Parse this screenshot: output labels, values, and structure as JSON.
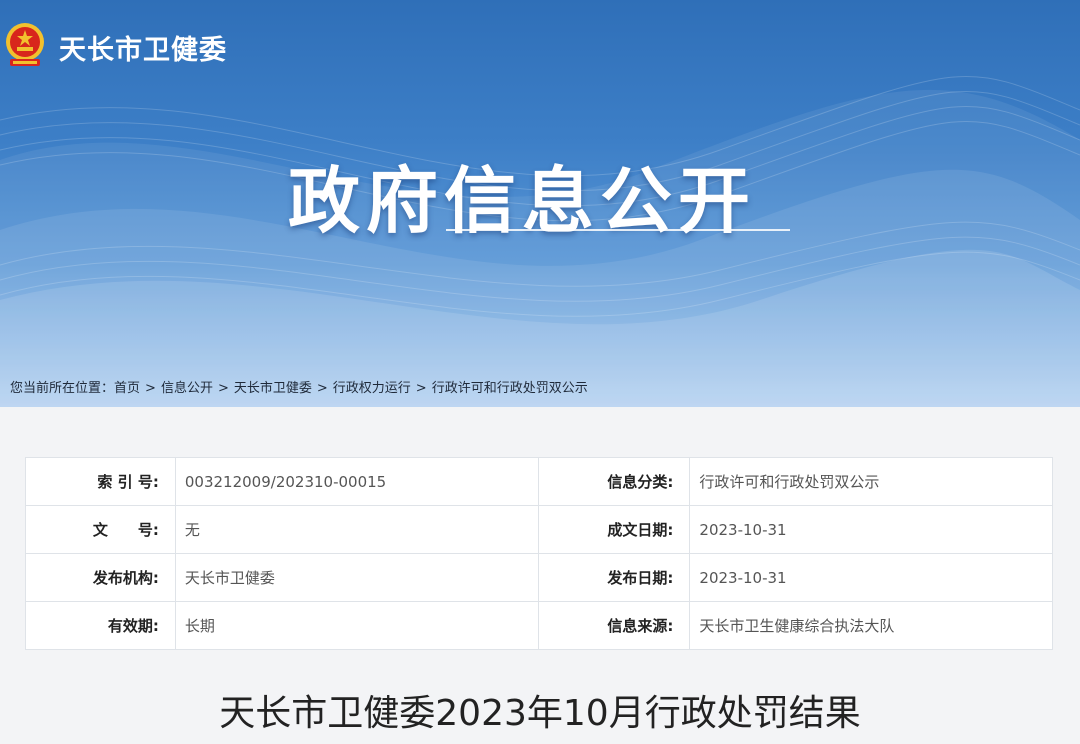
{
  "header": {
    "site_name": "天长市卫健委",
    "hero_title": "政府信息公开"
  },
  "breadcrumb": {
    "prefix": "您当前所在位置：",
    "items": [
      "首页",
      "信息公开",
      "天长市卫健委",
      "行政权力运行",
      "行政许可和行政处罚双公示"
    ]
  },
  "info": {
    "rows": [
      {
        "l1": "索 引 号:",
        "v1": "003212009/202310-00015",
        "l2": "信息分类:",
        "v2": "行政许可和行政处罚双公示"
      },
      {
        "l1": "文　　号:",
        "v1": "无",
        "l2": "成文日期:",
        "v2": "2023-10-31"
      },
      {
        "l1": "发布机构:",
        "v1": "天长市卫健委",
        "l2": "发布日期:",
        "v2": "2023-10-31"
      },
      {
        "l1": "有效期:",
        "v1": "长期",
        "l2": "信息来源:",
        "v2": "天长市卫生健康综合执法大队"
      }
    ]
  },
  "document": {
    "title": "天长市卫健委2023年10月行政处罚结果"
  },
  "colors": {
    "banner_top": "#2f6fb8",
    "banner_bottom": "#a9caef",
    "page_bg": "#f3f4f6",
    "emblem_red": "#d8261c",
    "emblem_gold": "#f2c12e"
  },
  "icons": {
    "emblem": "national-emblem-icon"
  }
}
